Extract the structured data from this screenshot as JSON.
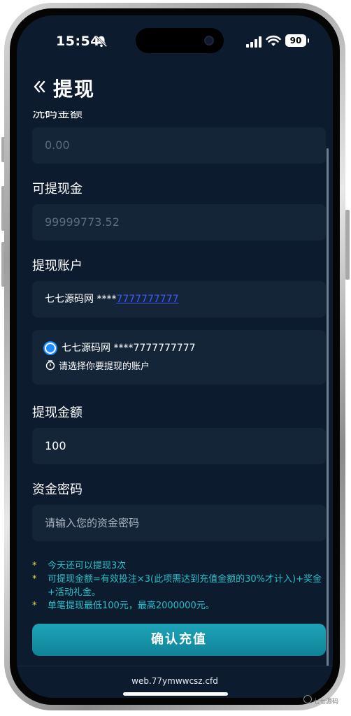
{
  "status": {
    "time": "15:54",
    "battery": "90"
  },
  "header": {
    "title": "提现"
  },
  "form": {
    "wash_label": "洗码金额",
    "wash_value": "0.00",
    "withdrawable_label": "可提现金",
    "withdrawable_value": "99999773.52",
    "account_label": "提现账户",
    "account_name": "七七源码网 ****",
    "account_number": "7777777777",
    "select_option": "七七源码网 ****7777777777",
    "select_hint": "请选择你要提现的账户",
    "amount_label": "提现金额",
    "amount_value": "100",
    "password_label": "资金密码",
    "password_placeholder": "请输入您的资金密码"
  },
  "notes": [
    "今天还可以提现3次",
    "可提现金额=有效投注×3(此项需达到充值金额的30%才计入)+奖金+活动礼金。",
    "单笔提现最低100元，最高2000000元。"
  ],
  "confirm_label": "确认充值",
  "url": "web.77ymwwcsz.cfd",
  "watermark": "七七源码",
  "colors": {
    "background": "#0c1b2e",
    "field": "#152538",
    "accent": "#1ea4b8",
    "note": "#27c0c8",
    "link": "#3b5bff"
  }
}
